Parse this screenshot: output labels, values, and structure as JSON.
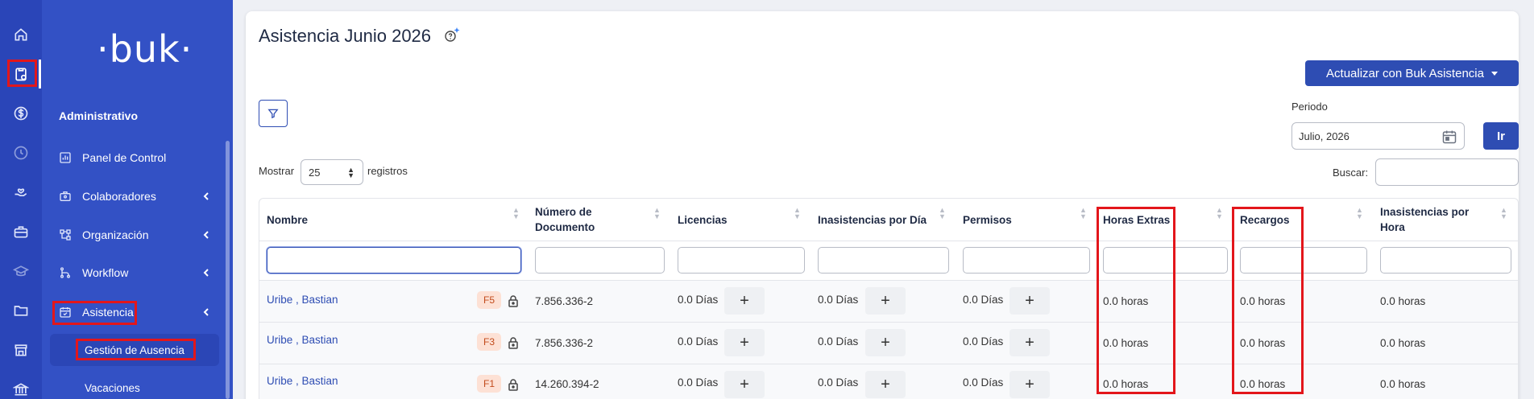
{
  "sidebar": {
    "logo": "·buk·",
    "section_title": "Administrativo",
    "items": [
      {
        "label": "Panel de Control"
      },
      {
        "label": "Colaboradores"
      },
      {
        "label": "Organización"
      },
      {
        "label": "Workflow"
      },
      {
        "label": "Asistencia"
      }
    ],
    "sub_items": [
      {
        "label": "Gestión de Ausencia"
      },
      {
        "label": "Vacaciones"
      }
    ]
  },
  "header": {
    "title": "Asistencia Junio 2026",
    "update_button": "Actualizar con Buk Asistencia"
  },
  "period": {
    "label": "Periodo",
    "value": "Julio, 2026",
    "go_button": "Ir"
  },
  "table_controls": {
    "show_label": "Mostrar",
    "entries_value": "25",
    "records_label": "registros",
    "search_label": "Buscar:"
  },
  "table": {
    "columns": [
      "Nombre",
      "Número de Documento",
      "Licencias",
      "Inasistencias por Día",
      "Permisos",
      "Horas Extras",
      "Recargos",
      "Inasistencias por Hora"
    ],
    "rows": [
      {
        "name": "Uribe , Bastian",
        "badge": "F5",
        "doc": "7.856.336-2",
        "licencias": "0.0 Días",
        "inasistencias_dia": "0.0 Días",
        "permisos": "0.0 Días",
        "horas_extras": "0.0 horas",
        "recargos": "0.0 horas",
        "inasistencias_hora": "0.0 horas"
      },
      {
        "name": "Uribe , Bastian",
        "badge": "F3",
        "doc": "7.856.336-2",
        "licencias": "0.0 Días",
        "inasistencias_dia": "0.0 Días",
        "permisos": "0.0 Días",
        "horas_extras": "0.0 horas",
        "recargos": "0.0 horas",
        "inasistencias_hora": "0.0 horas"
      },
      {
        "name": "Uribe , Bastian",
        "badge": "F1",
        "doc": "14.260.394-2",
        "licencias": "0.0 Días",
        "inasistencias_dia": "0.0 Días",
        "permisos": "0.0 Días",
        "horas_extras": "0.0 horas",
        "recargos": "0.0 horas",
        "inasistencias_hora": "0.0 horas"
      }
    ]
  },
  "colors": {
    "rail": "#2a45b8",
    "sidebar": "#3351c5",
    "accent": "#2e4db3",
    "highlight_box": "#e3161b",
    "badge_bg": "#fde1d5",
    "badge_text": "#c24b1c"
  }
}
